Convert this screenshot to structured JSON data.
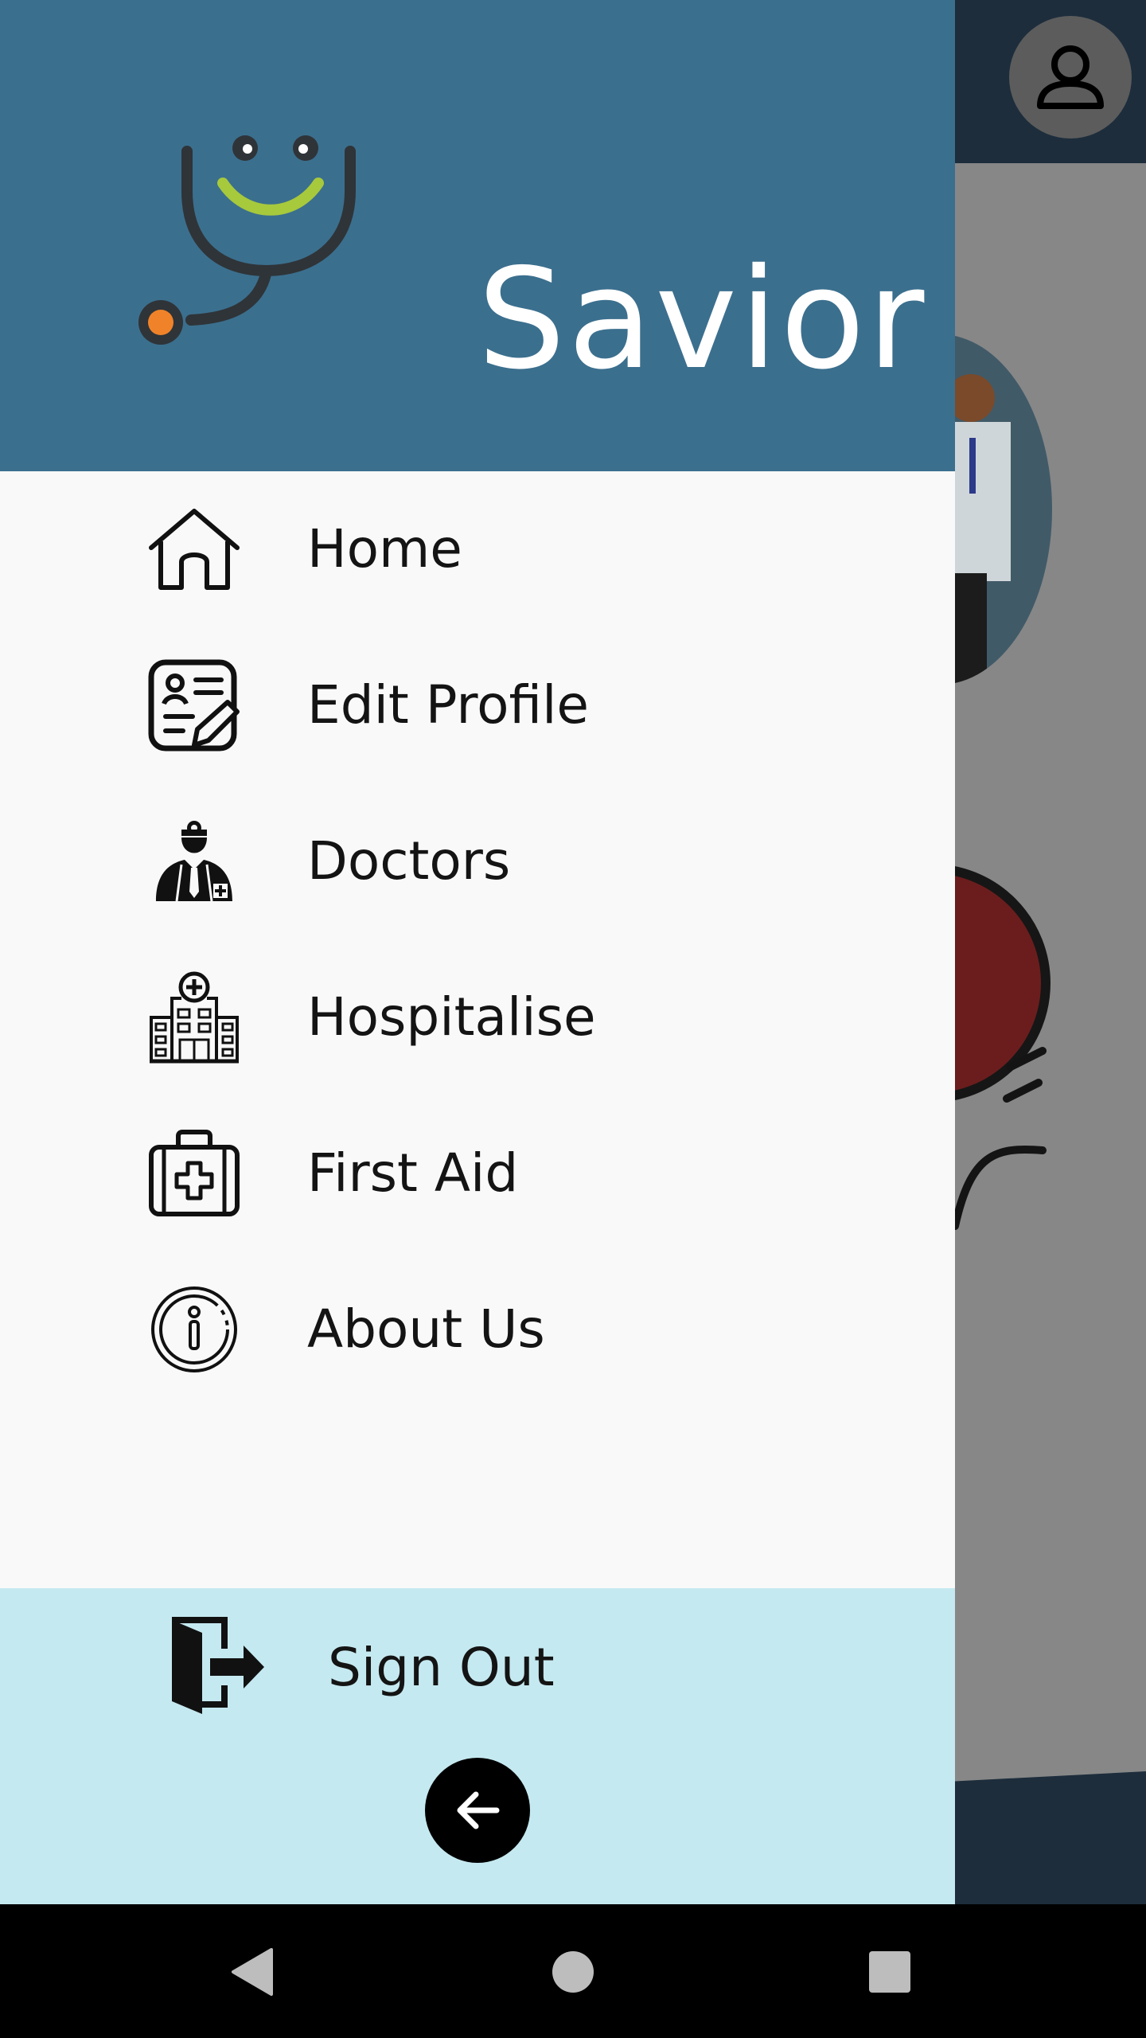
{
  "app": {
    "title": "Savior"
  },
  "menu": {
    "items": [
      {
        "label": "Home",
        "icon": "home-icon"
      },
      {
        "label": "Edit Profile",
        "icon": "edit-profile-icon"
      },
      {
        "label": "Doctors",
        "icon": "doctor-icon"
      },
      {
        "label": "Hospitalise",
        "icon": "hospital-icon"
      },
      {
        "label": "First Aid",
        "icon": "first-aid-kit-icon"
      },
      {
        "label": "About Us",
        "icon": "info-icon"
      }
    ]
  },
  "footer": {
    "signout_label": "Sign Out",
    "signout_icon": "exit-door-icon",
    "back_icon": "arrow-left-icon"
  },
  "colors": {
    "header": "#3b6f8e",
    "drawer_bg": "#f9f9f9",
    "footer_bg": "#c5e9f0",
    "logo_smile": "#a7c93c",
    "logo_dot": "#f0832a"
  },
  "system_nav": {
    "back": "triangle-back-icon",
    "home": "circle-home-icon",
    "recents": "square-recents-icon"
  }
}
